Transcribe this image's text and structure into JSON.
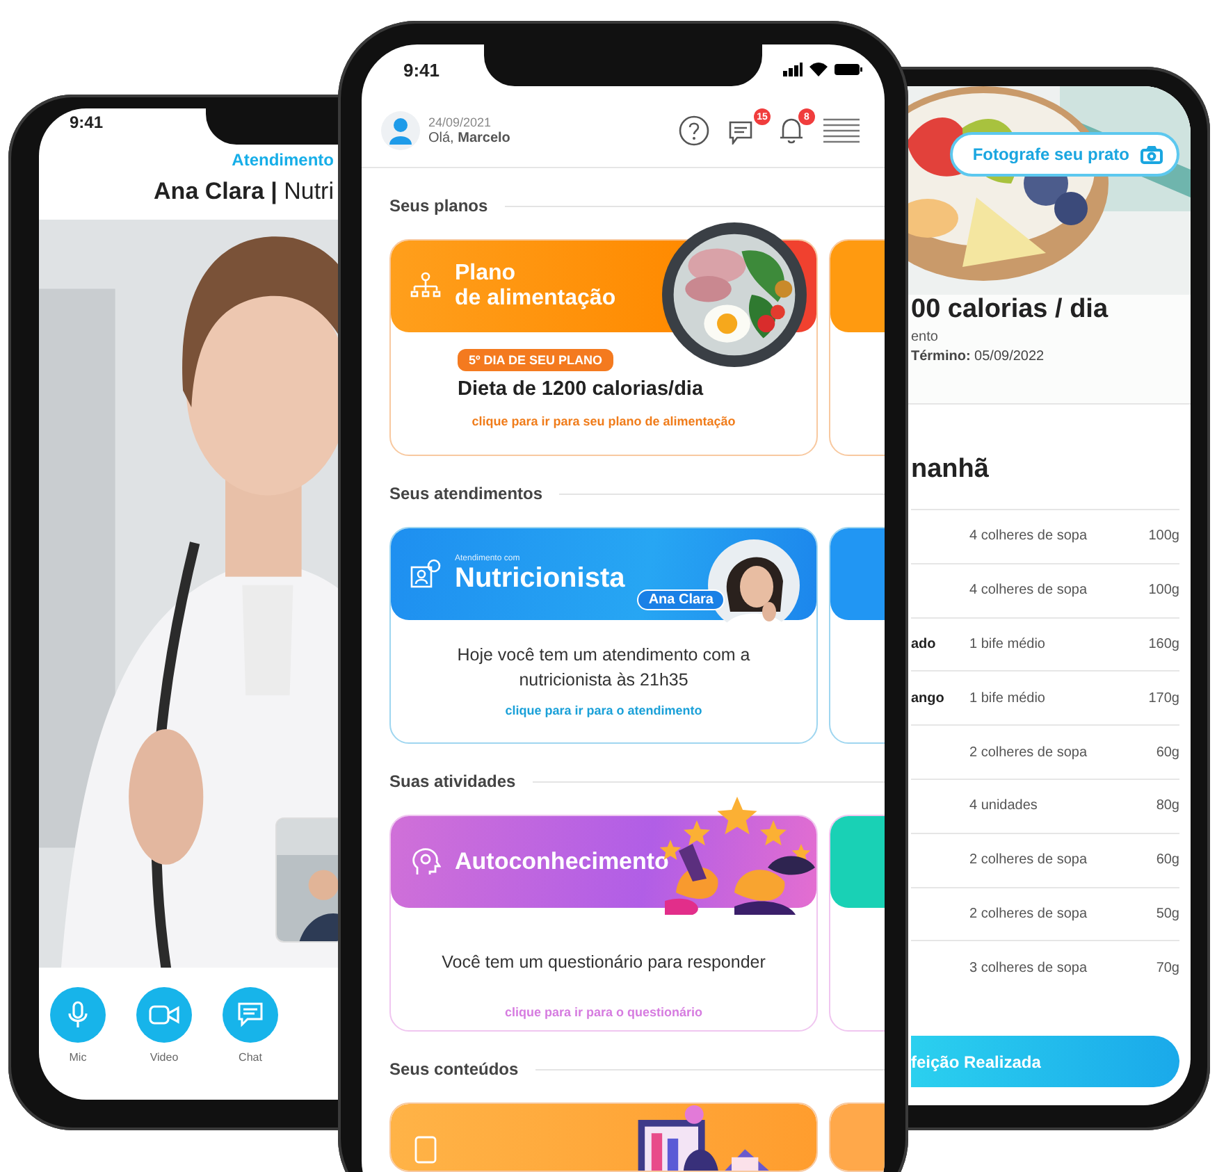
{
  "left_phone": {
    "time": "9:41",
    "header_label": "Atendimento",
    "header_title": "**Ana Clara |** Nutri",
    "controls": [
      {
        "kind": "mic",
        "label": "Mic"
      },
      {
        "kind": "video",
        "label": "Video"
      },
      {
        "kind": "chat",
        "label": "Chat"
      }
    ]
  },
  "center_phone": {
    "time": "9:41",
    "date": "24/09/2021",
    "greeting": "Olá, **Marcelo**",
    "messages_badge": "15",
    "notifications_badge": "8",
    "sections": [
      {
        "title": "Seus planos",
        "card": {
          "kind": "plan",
          "title": "Plano",
          "subtitle": "de alimentação",
          "tag": "5º DIA DE SEU PLANO",
          "headline": "Dieta de 1200 calorias/dia",
          "link": "clique para ir para seu plano de alimentação"
        }
      },
      {
        "title": "Seus atendimentos",
        "card": {
          "kind": "appointment",
          "overline": "Atendimento com",
          "title": "Nutricionista",
          "name_tag": "Ana Clara",
          "message": "Hoje você tem um atendimento com a nutricionista às 21h35",
          "link": "clique para ir para o atendimento"
        }
      },
      {
        "title": "Suas atividades",
        "card": {
          "kind": "activity",
          "title": "Autoconhecimento",
          "message": "Você tem um questionário para responder",
          "link": "clique para ir para o questionário"
        }
      },
      {
        "title": "Seus conteúdos",
        "card": {
          "kind": "content"
        }
      }
    ]
  },
  "right_phone": {
    "photo_button": "Fotografe seu prato",
    "plan_title": "00 calorias / dia",
    "plan_subtitle": "ento",
    "end_date": "**Término:** 05/09/2022",
    "meal_title": "nanhã",
    "foods": [
      {
        "portion": "4 colheres de sopa",
        "weight": "100g"
      },
      {
        "portion": "4 colheres de sopa",
        "weight": "100g"
      },
      {
        "name": "ado",
        "portion": "1 bife médio",
        "weight": "160g"
      },
      {
        "name": "ango",
        "portion": "1 bife médio",
        "weight": "170g"
      },
      {
        "portion": "2 colheres de sopa",
        "weight": "60g"
      },
      {
        "portion": "4 unidades",
        "weight": "80g"
      },
      {
        "portion": "2 colheres de sopa",
        "weight": "60g"
      },
      {
        "portion": "2 colheres de sopa",
        "weight": "50g"
      },
      {
        "portion": "3 colheres de sopa",
        "weight": "70g"
      }
    ],
    "done_button": "feição Realizada"
  }
}
